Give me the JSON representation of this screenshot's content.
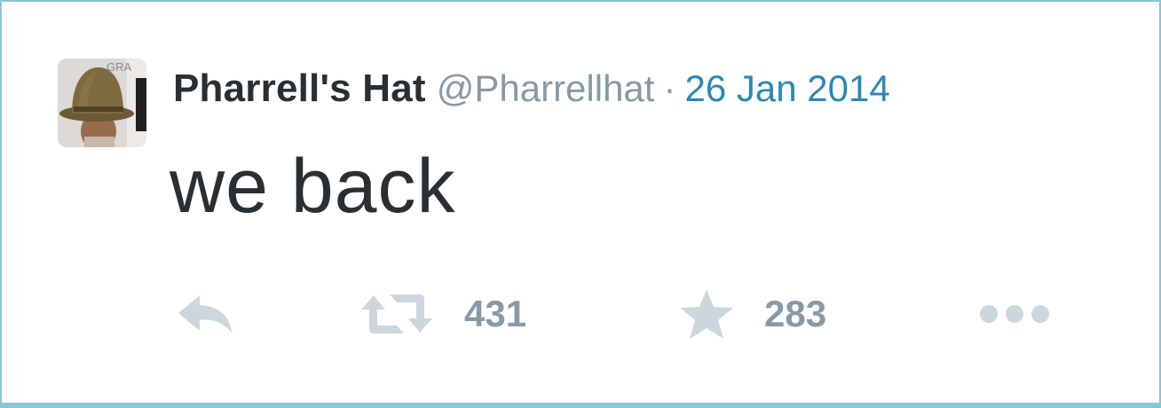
{
  "tweet": {
    "display_name": "Pharrell's Hat",
    "handle": "@Pharrellhat",
    "separator": "·",
    "timestamp": "26 Jan 2014",
    "text": "we back"
  },
  "avatar": {
    "icon": "profile-photo-hat",
    "background_text": "GRA"
  },
  "actions": {
    "reply": {
      "icon": "reply-icon"
    },
    "retweet": {
      "icon": "retweet-icon",
      "count": "431"
    },
    "favorite": {
      "icon": "star-icon",
      "count": "283"
    },
    "more": {
      "icon": "more-dots-icon"
    }
  },
  "colors": {
    "name": "#292f33",
    "handle": "#8899a6",
    "timestamp_link": "#2b88b4",
    "icon_gray": "#ccd6dd",
    "count_gray": "#8899a6",
    "border": "#8ec3d6"
  }
}
